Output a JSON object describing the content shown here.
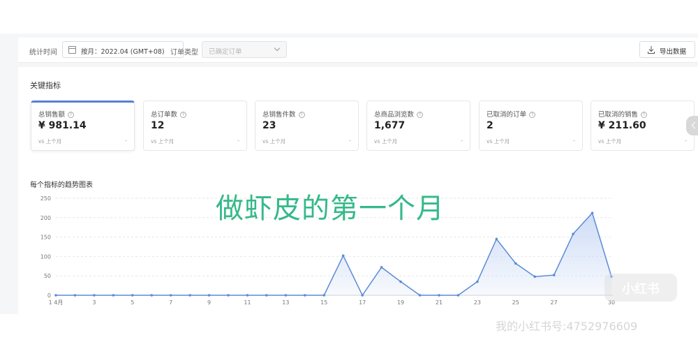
{
  "filters": {
    "time_label": "统计时间",
    "date_value": "按月：2022.04 (GMT+08)",
    "order_type_label": "订单类型",
    "order_type_value": "已确定订单",
    "export_label": "导出数据"
  },
  "metrics": {
    "section_title": "关键指标",
    "cards": [
      {
        "label": "总销售额",
        "value": "¥ 981.14",
        "compare": "vs 上个月",
        "change": "-"
      },
      {
        "label": "总订单数",
        "value": "12",
        "compare": "vs 上个月",
        "change": "-"
      },
      {
        "label": "总销售件数",
        "value": "23",
        "compare": "vs 上个月",
        "change": "-"
      },
      {
        "label": "总商品浏览数",
        "value": "1,677",
        "compare": "vs 上个月",
        "change": "-"
      },
      {
        "label": "已取消的订单",
        "value": "2",
        "compare": "vs 上个月",
        "change": "-"
      },
      {
        "label": "已取消的销售",
        "value": "¥ 211.60",
        "compare": "vs 上个月",
        "change": "-"
      }
    ]
  },
  "chart_section": {
    "title": "每个指标的趋势图表"
  },
  "chart_data": {
    "type": "area",
    "title": "",
    "xlabel": "",
    "ylabel": "",
    "x": [
      1,
      2,
      3,
      4,
      5,
      6,
      7,
      8,
      9,
      10,
      11,
      12,
      13,
      14,
      15,
      16,
      17,
      18,
      19,
      20,
      21,
      22,
      23,
      24,
      25,
      26,
      27,
      28,
      29,
      30
    ],
    "x_tick_labels": [
      "1 4月",
      "3",
      "5",
      "7",
      "9",
      "11",
      "13",
      "15",
      "17",
      "19",
      "21",
      "23",
      "25",
      "27",
      "30"
    ],
    "series": [
      {
        "values": [
          0,
          0,
          0,
          0,
          0,
          0,
          0,
          0,
          0,
          0,
          0,
          0,
          0,
          0,
          0,
          102,
          0,
          72,
          35,
          0,
          0,
          0,
          35,
          145,
          82,
          48,
          52,
          158,
          212,
          48
        ]
      }
    ],
    "ylim": [
      0,
      250
    ],
    "yticks": [
      0,
      50,
      100,
      150,
      200,
      250
    ],
    "grid": true,
    "line_color": "#5b8ad6",
    "fill_color": "#c9d9f5"
  },
  "overlay": {
    "caption": "做虾皮的第一个月",
    "logo_text": "小红书",
    "watermark": "我的小红书号:4752976609"
  }
}
